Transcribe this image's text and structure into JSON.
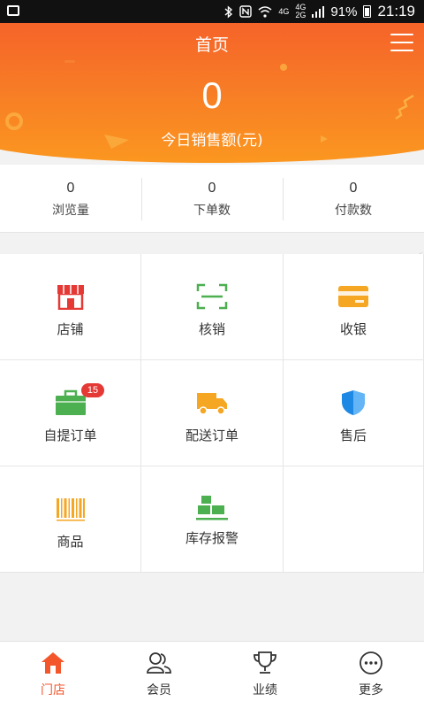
{
  "status_bar": {
    "network_top": "4G",
    "network_bottom": "4G",
    "network_bottom2": "2G",
    "battery_percent": "91%",
    "time": "21:19"
  },
  "header": {
    "title": "首页",
    "sales_value": "0",
    "sales_label": "今日销售额(元)"
  },
  "stats": [
    {
      "value": "0",
      "label": "浏览量"
    },
    {
      "value": "0",
      "label": "下单数"
    },
    {
      "value": "0",
      "label": "付款数"
    }
  ],
  "grid": [
    {
      "label": "店铺",
      "icon": "store-icon",
      "color": "#e53935"
    },
    {
      "label": "核销",
      "icon": "scan-icon",
      "color": "#4caf50"
    },
    {
      "label": "收银",
      "icon": "card-icon",
      "color": "#f5a623"
    },
    {
      "label": "自提订单",
      "icon": "briefcase-icon",
      "color": "#4caf50",
      "badge": "15"
    },
    {
      "label": "配送订单",
      "icon": "truck-icon",
      "color": "#f5a623"
    },
    {
      "label": "售后",
      "icon": "shield-icon",
      "color": "#1e88e5"
    },
    {
      "label": "商品",
      "icon": "barcode-icon",
      "color": "#f5a623"
    },
    {
      "label": "库存报警",
      "icon": "boxes-icon",
      "color": "#4caf50"
    }
  ],
  "tabs": [
    {
      "label": "门店",
      "icon": "home-icon",
      "active": true
    },
    {
      "label": "会员",
      "icon": "members-icon"
    },
    {
      "label": "业绩",
      "icon": "trophy-icon"
    },
    {
      "label": "更多",
      "icon": "more-icon"
    }
  ],
  "colors": {
    "brand": "#f4562b",
    "brand_light": "#fb9720"
  }
}
